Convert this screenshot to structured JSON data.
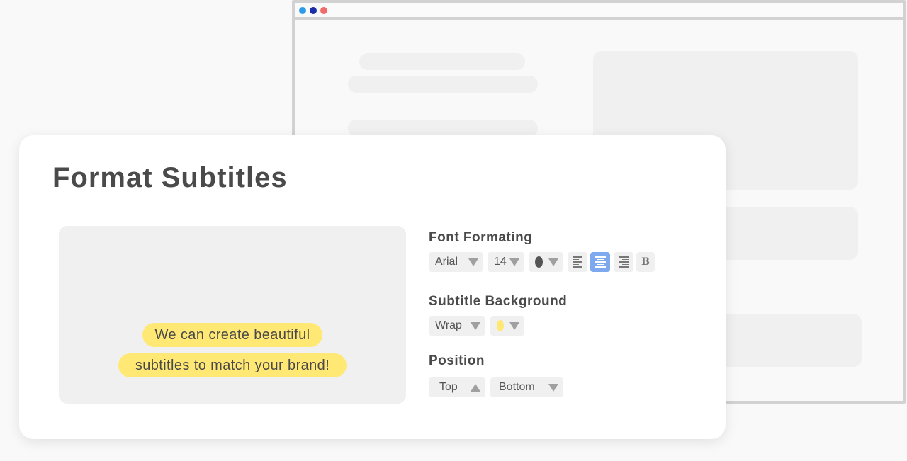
{
  "card": {
    "title": "Format Subtitles"
  },
  "preview": {
    "subtitle_line1": "We can create beautiful",
    "subtitle_line2": "subtitles to match your brand!"
  },
  "font_formatting": {
    "label": "Font Formating",
    "font_value": "Arial",
    "size_value": "14",
    "color_value": "#555555",
    "align_options": [
      "align-left",
      "align-center",
      "align-right"
    ],
    "align_selected": "align-center",
    "bold_label": "B"
  },
  "subtitle_background": {
    "label": "Subtitle Background",
    "style_value": "Wrap",
    "color_value": "#ffe873"
  },
  "position": {
    "label": "Position",
    "top_label": "Top",
    "bottom_label": "Bottom"
  },
  "colors": {
    "accent": "#7ea9ef",
    "subtitle_highlight": "#ffe873",
    "browser_dot_blue": "#2c9ce8",
    "browser_dot_navy": "#1c2fa8",
    "browser_dot_red": "#f26b6b"
  }
}
